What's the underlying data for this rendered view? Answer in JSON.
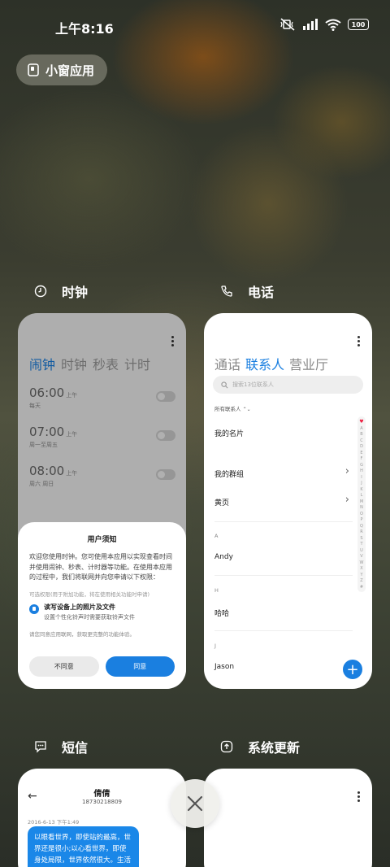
{
  "status_bar": {
    "time": "上午8:16",
    "battery": "100",
    "icons": [
      "mute-vibrate-icon",
      "signal-icon",
      "wifi-icon",
      "battery-icon"
    ]
  },
  "floating_window": {
    "label": "小窗应用",
    "icon": "floating-window-icon"
  },
  "apps": {
    "clock": {
      "name": "时钟",
      "icon": "clock-icon",
      "tabs": [
        "闹钟",
        "时钟",
        "秒表",
        "计时"
      ],
      "active_tab": 0,
      "alarms": [
        {
          "time": "06:00",
          "ampm": "上午",
          "repeat": "每天",
          "on": false
        },
        {
          "time": "07:00",
          "ampm": "上午",
          "repeat": "周一至周五",
          "on": false
        },
        {
          "time": "08:00",
          "ampm": "上午",
          "repeat": "周六 周日",
          "on": false
        }
      ],
      "dialog": {
        "title": "用户须知",
        "body": "欢迎您使用时钟。您可使用本应用以实现查看时间并使用闹钟、秒表、计时器等功能。在使用本应用的过程中，我们将联网并向您申请以下权限：",
        "hint": "可选权限(用于附加功能，将在使用相关功能时申请)",
        "permission_title": "读写设备上的照片及文件",
        "permission_desc": "设置个性化铃声时需要获取铃声文件",
        "network_hint": "请您同意应用联网，获取更完整的功能体验。",
        "deny_label": "不同意",
        "agree_label": "同意"
      }
    },
    "phone": {
      "name": "电话",
      "icon": "phone-icon",
      "tabs": [
        "通话",
        "联系人",
        "营业厅"
      ],
      "active_tab": 1,
      "search_placeholder": "搜索13位联系人",
      "filter": "所有联系人",
      "my_card": "我的名片",
      "my_groups": "我的群组",
      "yellow_pages": "黄页",
      "sections": [
        {
          "letter": "A",
          "contact": "Andy"
        },
        {
          "letter": "H",
          "contact": "哈哈"
        },
        {
          "letter": "J",
          "contact": "Jason"
        }
      ],
      "index": [
        "♥",
        "A",
        "B",
        "C",
        "D",
        "E",
        "F",
        "G",
        "H",
        "I",
        "J",
        "K",
        "L",
        "M",
        "N",
        "O",
        "P",
        "Q",
        "R",
        "S",
        "T",
        "U",
        "V",
        "W",
        "X",
        "Y",
        "Z",
        "#"
      ],
      "fab_label": "+"
    },
    "messages": {
      "name": "短信",
      "icon": "message-icon",
      "contact_name": "倩倩",
      "contact_number": "18730218809",
      "date": "2016-6-13 下午1:49",
      "bubble_text": "以眼看世界，即使站的最高，世界还是很小;以心看世界，即使身处局限，世界依然很大。生活远"
    },
    "update": {
      "name": "系统更新",
      "icon": "system-update-icon"
    }
  },
  "close_button": {
    "icon": "close-icon"
  }
}
